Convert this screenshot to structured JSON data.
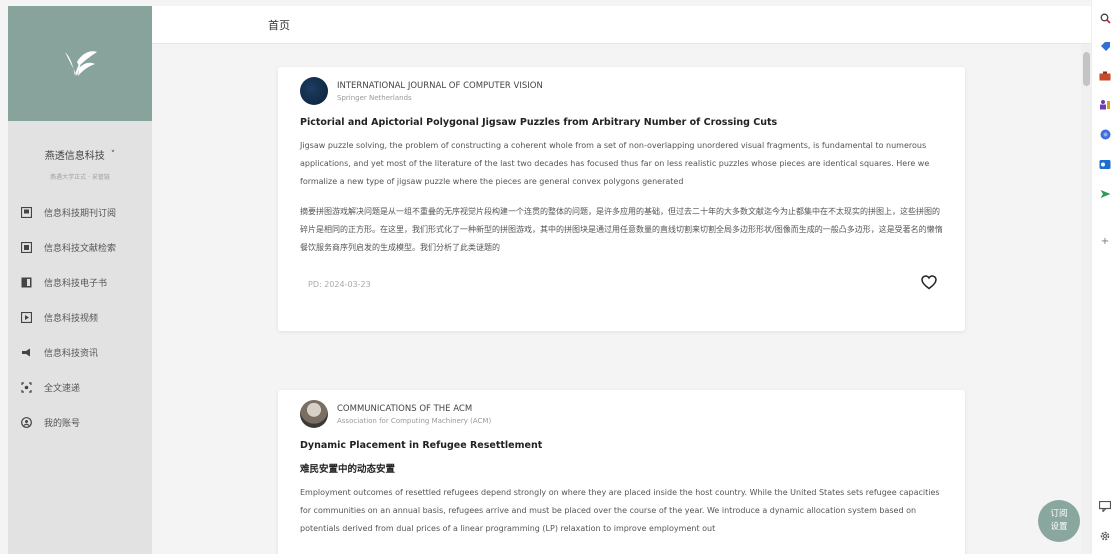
{
  "sidebar": {
    "org_name": "燕透信息科技",
    "org_sub": "燕遇大学正式 · 采管链",
    "items": [
      {
        "label": "信息科技期刊订阅",
        "icon": "journal-icon"
      },
      {
        "label": "信息科技文献检索",
        "icon": "document-search-icon"
      },
      {
        "label": "信息科技电子书",
        "icon": "book-icon"
      },
      {
        "label": "信息科技视频",
        "icon": "video-icon"
      },
      {
        "label": "信息科技资讯",
        "icon": "megaphone-icon"
      },
      {
        "label": "全文速递",
        "icon": "fulltext-icon"
      },
      {
        "label": "我的账号",
        "icon": "account-icon"
      }
    ]
  },
  "topbar": {
    "title": "首页"
  },
  "cards": [
    {
      "journal": "INTERNATIONAL JOURNAL OF COMPUTER VISION",
      "publisher": "Springer Netherlands",
      "title": "Pictorial and Apictorial Polygonal Jigsaw Puzzles from Arbitrary Number of Crossing Cuts",
      "abstract": "Jigsaw puzzle solving, the problem of constructing a coherent whole from a set of non-overlapping unordered visual fragments, is fundamental to numerous applications, and yet most of the literature of the last two decades has focused thus far on less realistic puzzles whose pieces are identical squares. Here we formalize a new type of jigsaw puzzle where the pieces are general convex polygons generated",
      "abstract_cn": "摘要拼图游戏解决问题是从一组不重叠的无序视觉片段构建一个连贯的整体的问题，是许多应用的基础，但过去二十年的大多数文献迄今为止都集中在不太现实的拼图上，这些拼图的碎片是相同的正方形。在这里，我们形式化了一种新型的拼图游戏，其中的拼图块是通过用任意数量的直线切割来切割全局多边形形状/图像而生成的一般凸多边形，这是受著名的懒惰餐饮服务商序列启发的生成模型。我们分析了此类谜题的",
      "date": "PD: 2024-03-23"
    },
    {
      "journal": "COMMUNICATIONS OF THE ACM",
      "publisher": "Association for Computing Machinery (ACM)",
      "title": "Dynamic Placement in Refugee Resettlement",
      "title_cn": "难民安置中的动态安置",
      "abstract": "Employment outcomes of resettled refugees depend strongly on where they are placed inside the host country. While the United States sets refugee capacities for communities on an annual basis, refugees arrive and must be placed over the course of the year. We introduce a dynamic allocation system based on potentials derived from dual prices of a linear programming (LP) relaxation to improve employment out"
    }
  ],
  "float_button": {
    "line1": "订阅",
    "line2": "设置"
  },
  "colors": {
    "brand": "#87a39b",
    "sidebar_bg": "#e2e2e2"
  }
}
